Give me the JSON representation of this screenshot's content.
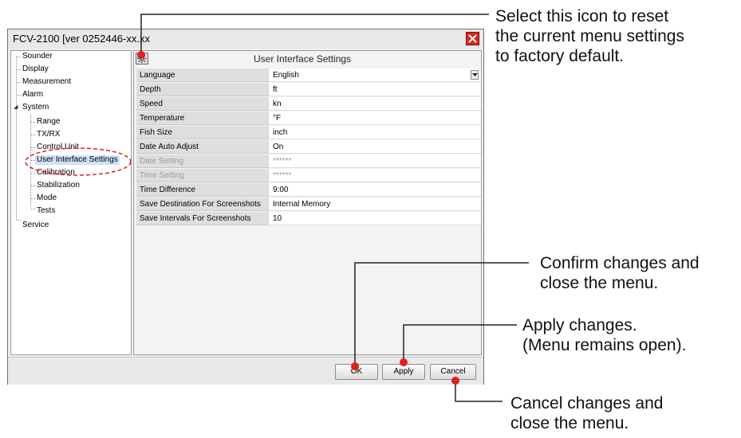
{
  "window": {
    "title": "FCV-2100 [ver 0252446-xx.xx",
    "close_icon": "close-icon"
  },
  "tree": {
    "items": [
      {
        "label": "Sounder"
      },
      {
        "label": "Display"
      },
      {
        "label": "Measurement"
      },
      {
        "label": "Alarm"
      },
      {
        "label": "System"
      },
      {
        "label": "Range"
      },
      {
        "label": "TX/RX"
      },
      {
        "label": "Control Unit"
      },
      {
        "label": "User Interface Settings"
      },
      {
        "label": "Calibration"
      },
      {
        "label": "Stabilization"
      },
      {
        "label": "Mode"
      },
      {
        "label": "Tests"
      },
      {
        "label": "Service"
      }
    ]
  },
  "panel": {
    "title": "User Interface Settings",
    "reset_icon": "reset-default-icon"
  },
  "settings": [
    {
      "label": "Language",
      "value": "English"
    },
    {
      "label": "Depth",
      "value": "ft"
    },
    {
      "label": "Speed",
      "value": "kn"
    },
    {
      "label": "Temperature",
      "value": "°F"
    },
    {
      "label": "Fish Size",
      "value": "inch"
    },
    {
      "label": "Date Auto Adjust",
      "value": "On"
    },
    {
      "label": "Date Setting",
      "value": "******"
    },
    {
      "label": "Time Setting",
      "value": "******"
    },
    {
      "label": "Time Difference",
      "value": "9:00"
    },
    {
      "label": "Save Destination For Screenshots",
      "value": "Internal Memory"
    },
    {
      "label": "Save Intervals For Screenshots",
      "value": "10"
    }
  ],
  "buttons": {
    "ok": "OK",
    "apply": "Apply",
    "cancel": "Cancel"
  },
  "callouts": {
    "reset": [
      "Select this icon to reset",
      "the current menu settings",
      "to factory default."
    ],
    "ok": [
      "Confirm changes and",
      "close the menu."
    ],
    "apply": [
      "Apply changes.",
      "(Menu remains open)."
    ],
    "cancel": [
      "Cancel changes and",
      "close the menu."
    ]
  },
  "colors": {
    "callout_line": "#e02020",
    "selected_item": "#cde3f7",
    "close_button": "#d9261c"
  }
}
